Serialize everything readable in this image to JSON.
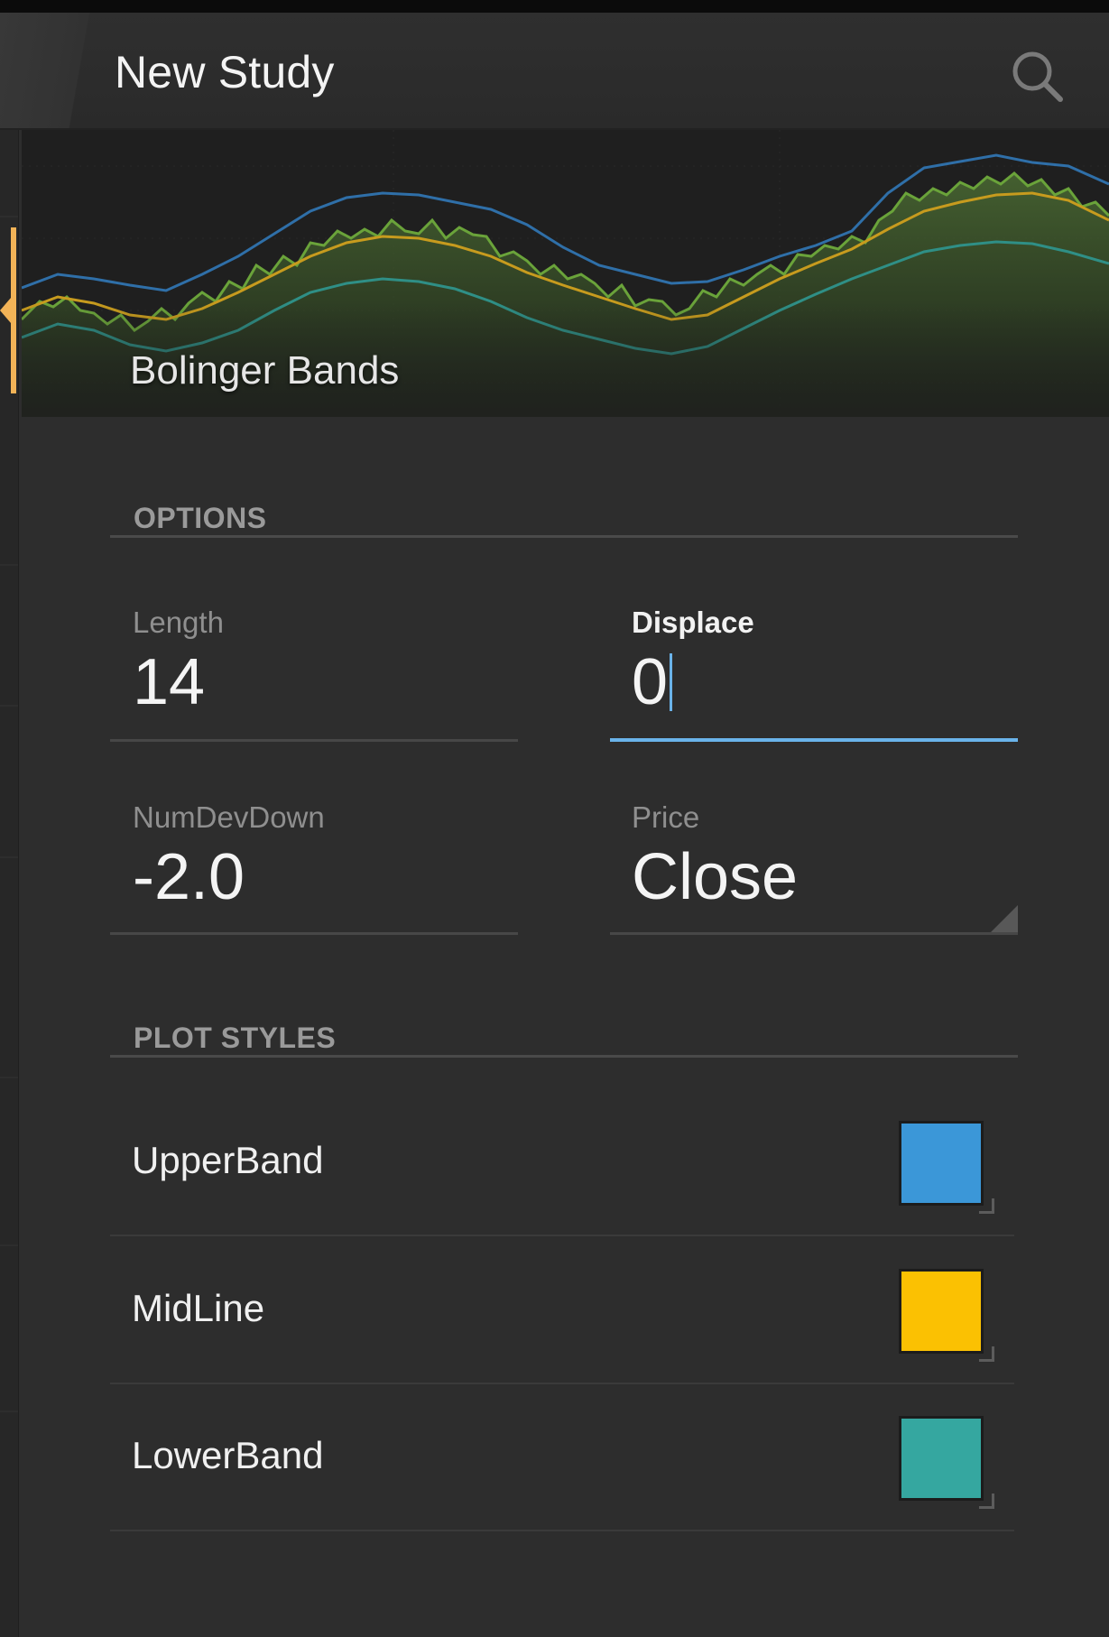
{
  "header": {
    "title": "New Study",
    "search_icon": "search-icon"
  },
  "preview": {
    "study_name": "Bolinger Bands",
    "colors": {
      "upper": "#2f6fa8",
      "mid": "#c79b1e",
      "lower": "#2f8f86",
      "price": "#6aa33a",
      "price_fill": "#3b5a2a"
    }
  },
  "options": {
    "section_title": "OPTIONS",
    "length": {
      "label": "Length",
      "value": "14"
    },
    "displace": {
      "label": "Displace",
      "value": "0"
    },
    "num_dev_down": {
      "label": "NumDevDown",
      "value": "-2.0"
    },
    "price": {
      "label": "Price",
      "value": "Close"
    }
  },
  "plot_styles": {
    "section_title": "PLOT STYLES",
    "items": [
      {
        "label": "UpperBand",
        "color": "#3b97d8"
      },
      {
        "label": "MidLine",
        "color": "#fbc102"
      },
      {
        "label": "LowerBand",
        "color": "#35a7a0"
      }
    ]
  }
}
